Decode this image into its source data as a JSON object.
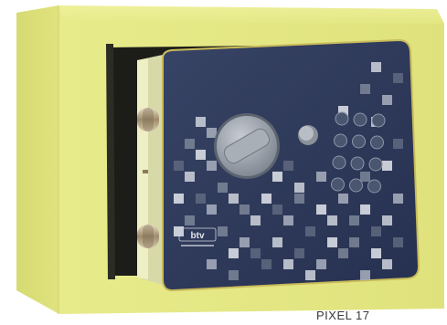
{
  "product": {
    "brand_text": "btv",
    "caption": "PIXEL 17"
  },
  "colors": {
    "safe_body": "#e9ec8c",
    "safe_body_shadow": "#c8cc5e",
    "door_panel": "#2f3a58",
    "door_panel_dark": "#1f2740",
    "knob": "#9aa2ad",
    "bolt_chrome": "#b9a98c",
    "keypad_key": "#4a5570"
  }
}
